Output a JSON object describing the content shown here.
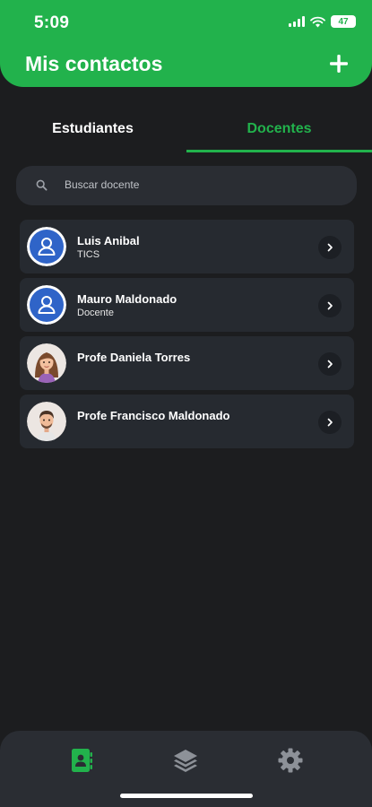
{
  "status_bar": {
    "time": "5:09",
    "battery": "47"
  },
  "header": {
    "title": "Mis contactos",
    "add_icon": "plus-icon"
  },
  "tabs": [
    {
      "label": "Estudiantes",
      "active": false
    },
    {
      "label": "Docentes",
      "active": true
    }
  ],
  "search": {
    "placeholder": "Buscar docente",
    "value": "",
    "icon": "search-icon"
  },
  "contacts": [
    {
      "name": "Luis Anibal",
      "subtitle": "TICS",
      "avatar": "default-user-avatar"
    },
    {
      "name": "Mauro Maldonado",
      "subtitle": "Docente",
      "avatar": "default-user-avatar"
    },
    {
      "name": "Profe Daniela Torres",
      "subtitle": "",
      "avatar": "female-cartoon-avatar"
    },
    {
      "name": "Profe Francisco Maldonado",
      "subtitle": "",
      "avatar": "male-cartoon-avatar"
    }
  ],
  "bottom_nav": [
    {
      "icon": "contacts-book-icon",
      "active": true
    },
    {
      "icon": "layers-icon",
      "active": false
    },
    {
      "icon": "gear-icon",
      "active": false
    }
  ],
  "colors": {
    "accent": "#22b24c",
    "background": "#1c1d1f",
    "card": "#262a30"
  }
}
